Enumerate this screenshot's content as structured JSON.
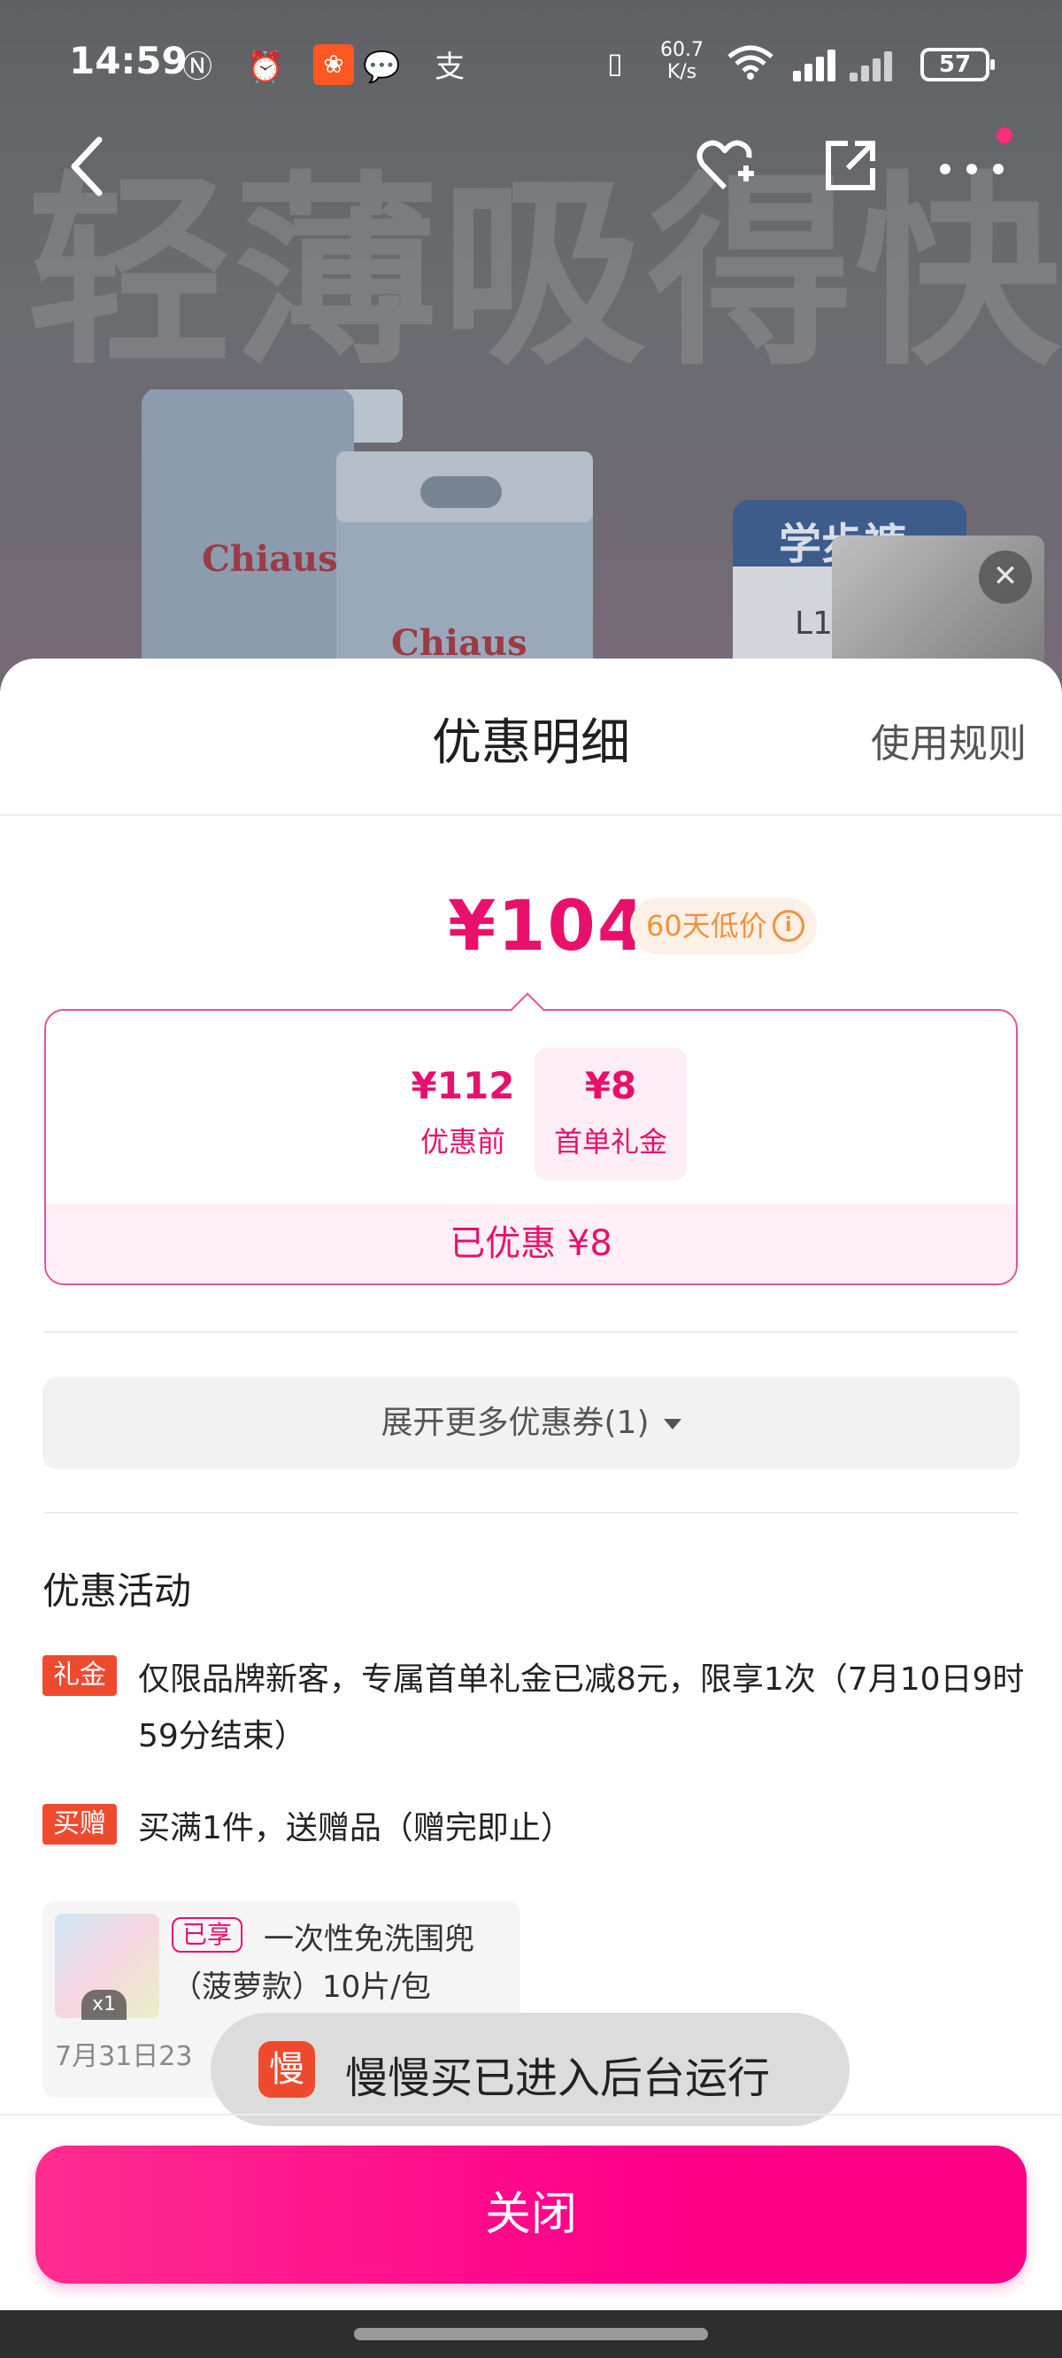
{
  "status_bar": {
    "time": "14:59",
    "left_icons": "Ⓝ ⏰ ✱",
    "app_icon": "❀",
    "extra_icons": "💬 支",
    "net_speed_value": "60.7",
    "net_speed_unit": "K/s",
    "battery": "57"
  },
  "background": {
    "slogan": "轻薄吸得快",
    "brand": "Chiaus",
    "box_label": "学步裤",
    "box_size": "L1"
  },
  "sheet": {
    "title": "优惠明细",
    "rules_link": "使用规则",
    "final_price": "¥104",
    "low_price_badge": "60天低价",
    "info_icon": "i",
    "calc": {
      "before_amount": "¥112",
      "before_label": "优惠前",
      "operator": "-",
      "gift_amount": "¥8",
      "gift_label": "首单礼金",
      "saved": "已优惠 ¥8"
    },
    "expand_more": "展开更多优惠券(1)",
    "activity_title": "优惠活动",
    "promos": [
      {
        "tag": "礼金",
        "text": "仅限品牌新客，专属首单礼金已减8元，限享1次（7月10日9时59分结束）"
      },
      {
        "tag": "买赠",
        "text": "买满1件，送赠品（赠完即止）"
      }
    ],
    "gift": {
      "qty": "x1",
      "tag": "已享",
      "name": "一次性免洗围兜（菠萝款）10片/包",
      "deadline": "7月31日23"
    },
    "toast": {
      "icon": "慢",
      "text": "慢慢买已进入后台运行"
    },
    "close_button": "关闭"
  },
  "colors": {
    "accent_pink": "#e8106b",
    "button_pink": "#ff008a",
    "tag_red": "#f04a2e",
    "badge_orange": "#f0923a"
  }
}
